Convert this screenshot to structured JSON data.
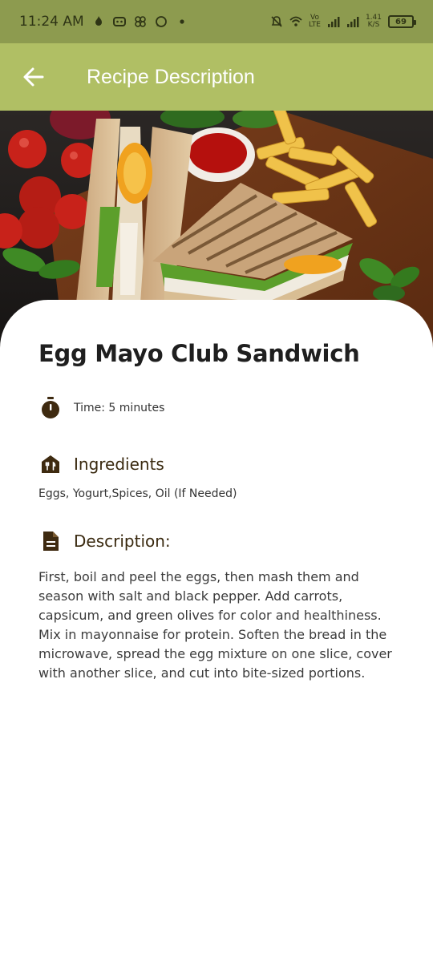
{
  "status_bar": {
    "time": "11:24 AM",
    "net_speed_top": "1.41",
    "net_speed_bottom": "K/S",
    "volte_top": "Vo",
    "volte_bottom": "LTE",
    "battery": "69"
  },
  "app_bar": {
    "title": "Recipe Description",
    "back_icon": "arrow-left-icon"
  },
  "recipe": {
    "title": "Egg Mayo Club Sandwich",
    "time_label": "Time: 5 minutes",
    "ingredients_heading": "Ingredients",
    "ingredients": "Eggs, Yogurt,Spices, Oil (If Needed)",
    "description_heading": "Description:",
    "description": "First, boil and peel the eggs, then mash them and season with salt and black pepper. Add carrots, capsicum, and green olives for color and healthiness. Mix in mayonnaise for protein. Soften the bread in the microwave, spread the egg mixture on one slice, cover with another slice, and cut into bite-sized portions."
  },
  "colors": {
    "status_bar": "#8d9b4f",
    "app_bar": "#b0bf64",
    "icon_brown": "#3e2a10"
  }
}
